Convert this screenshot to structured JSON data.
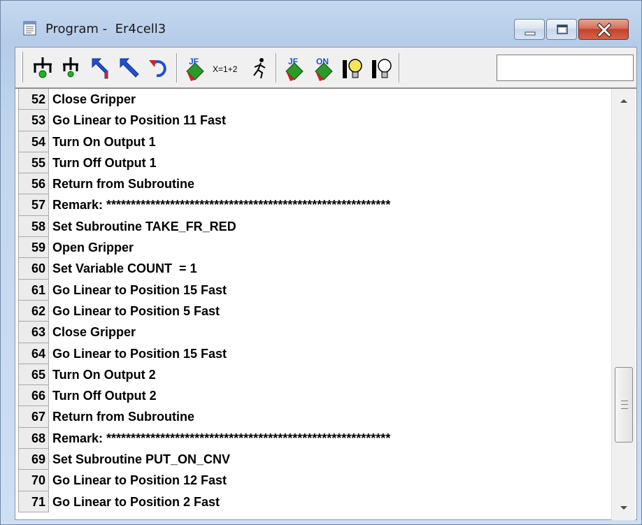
{
  "window": {
    "title": "Program -  Er4cell3",
    "icon": "notepad-icon",
    "controls": [
      "minimize-icon",
      "maximize-icon",
      "close-icon"
    ]
  },
  "toolbar": {
    "buttons": [
      "robot-gripper-green-icon",
      "robot-gripper-red-icon",
      "arrow-up-left-red-icon",
      "arrow-up-left-blue-icon",
      "undo-loop-icon",
      "jump-label-icon",
      "variable-math-icon",
      "running-man-icon",
      "jump-if-icon",
      "output-on-icon",
      "lightbulb-on-icon",
      "lightbulb-off-icon"
    ],
    "math_label": "X=1+2",
    "jump_label": "JF",
    "jump_if_label": "JF",
    "output_on_label": "ON",
    "input_value": ""
  },
  "program": {
    "lines": [
      {
        "num": "52",
        "text": "Close Gripper"
      },
      {
        "num": "53",
        "text": "Go Linear to Position 11 Fast"
      },
      {
        "num": "54",
        "text": "Turn On Output 1"
      },
      {
        "num": "55",
        "text": "Turn Off Output 1"
      },
      {
        "num": "56",
        "text": "Return from Subroutine"
      },
      {
        "num": "57",
        "text": "Remark: **********************************************************"
      },
      {
        "num": "58",
        "text": "Set Subroutine TAKE_FR_RED"
      },
      {
        "num": "59",
        "text": "Open Gripper"
      },
      {
        "num": "60",
        "text": "Set Variable COUNT  = 1"
      },
      {
        "num": "61",
        "text": "Go Linear to Position 15 Fast"
      },
      {
        "num": "62",
        "text": "Go Linear to Position 5 Fast"
      },
      {
        "num": "63",
        "text": "Close Gripper"
      },
      {
        "num": "64",
        "text": "Go Linear to Position 15 Fast"
      },
      {
        "num": "65",
        "text": "Turn On Output 2"
      },
      {
        "num": "66",
        "text": "Turn Off Output 2"
      },
      {
        "num": "67",
        "text": "Return from Subroutine"
      },
      {
        "num": "68",
        "text": "Remark: **********************************************************"
      },
      {
        "num": "69",
        "text": "Set Subroutine PUT_ON_CNV"
      },
      {
        "num": "70",
        "text": "Go Linear to Position 12 Fast"
      },
      {
        "num": "71",
        "text": "Go Linear to Position 2 Fast"
      }
    ]
  },
  "scrollbar": {
    "position_fraction": 0.68,
    "icons": [
      "scroll-up-arrow-icon",
      "scroll-down-arrow-icon"
    ]
  },
  "colors": {
    "title_bar": "#c5d8ef",
    "close_button": "#c4412a",
    "row_number_bg": "#ececec"
  }
}
